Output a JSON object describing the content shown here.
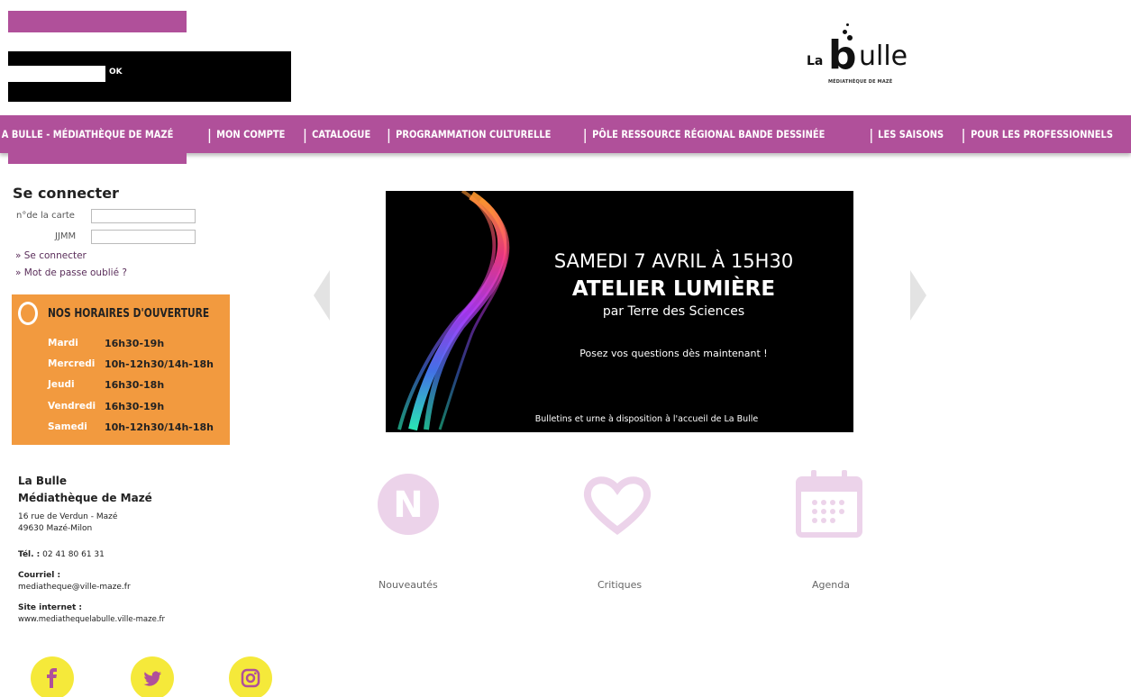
{
  "search": {
    "value": "",
    "ok_label": "OK"
  },
  "logo": {
    "la": "La",
    "b": "b",
    "ulle": "ulle",
    "subtitle": "MÉDIATHÈQUE DE MAZÉ"
  },
  "nav": {
    "items": [
      "A BULLE - MÉDIATHÈQUE DE MAZÉ",
      "MON COMPTE",
      "CATALOGUE",
      "PROGRAMMATION CULTURELLE",
      "PÔLE RESSOURCE RÉGIONAL BANDE DESSINÉE",
      "LES SAISONS",
      "POUR LES PROFESSIONNELS"
    ]
  },
  "login": {
    "title": "Se connecter",
    "card_label": "n°de la carte",
    "pass_label": "JJMM",
    "connect_link": "» Se connecter",
    "forgot_link": "» Mot de passe oublié ?"
  },
  "hours": {
    "title": "NOS HORAIRES D'OUVERTURE",
    "rows": [
      {
        "day": "Mardi",
        "time": "16h30-19h"
      },
      {
        "day": "Mercredi",
        "time": "10h-12h30/14h-18h"
      },
      {
        "day": "Jeudi",
        "time": "16h30-18h"
      },
      {
        "day": "Vendredi",
        "time": "16h30-19h"
      },
      {
        "day": "Samedi",
        "time": "10h-12h30/14h-18h"
      }
    ]
  },
  "contact": {
    "name1": "La Bulle",
    "name2": "Médiathèque de Mazé",
    "address1": "16 rue de Verdun - Mazé",
    "address2": "49630 Mazé-Milon",
    "tel_label": "Tél. :",
    "tel_value": " 02 41 80 61 31",
    "email_label": "Courriel :",
    "email_value": "mediatheque@ville-maze.fr",
    "site_label": "Site internet :",
    "site_value": "www.mediathequelabulle.ville-maze.fr"
  },
  "banner": {
    "line1": "SAMEDI 7 AVRIL À 15H30",
    "line2": "ATELIER LUMIÈRE",
    "line3": "par Terre des Sciences",
    "line4": "Posez vos questions dès maintenant !",
    "line5": "Bulletins et urne à disposition à l'accueil de La Bulle"
  },
  "quicklinks": {
    "nouveautes": "Nouveautés",
    "critiques": "Critiques",
    "agenda": "Agenda",
    "n_letter": "N"
  },
  "colors": {
    "brand": "#b0509a",
    "hours_bg": "#f29a3f",
    "social": "#f5e93a",
    "icon_faded": "#ecd3ea"
  }
}
